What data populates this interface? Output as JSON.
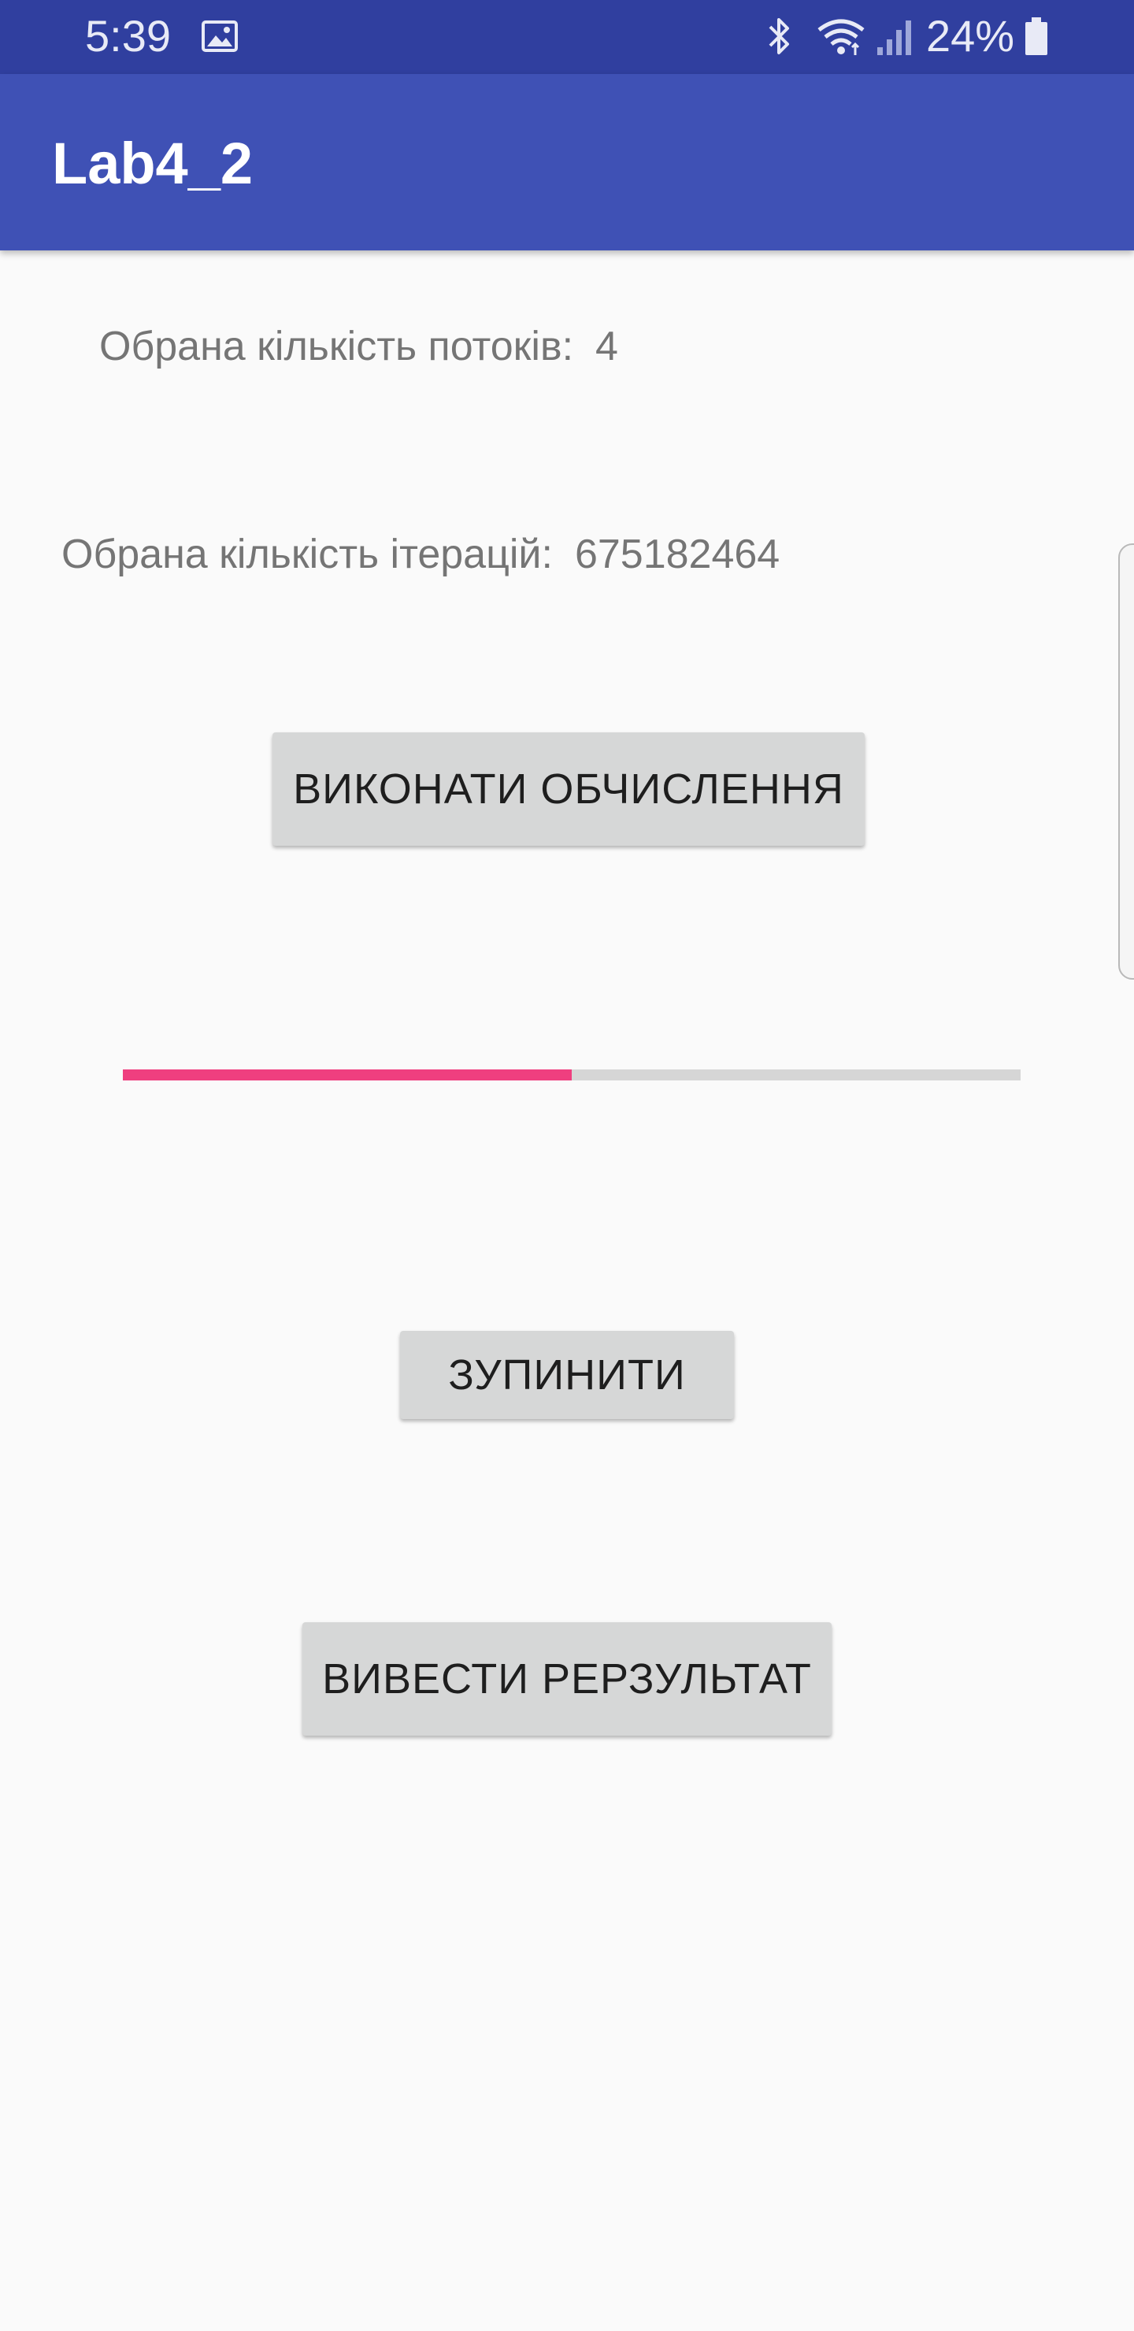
{
  "status_bar": {
    "time": "5:39",
    "battery": "24%",
    "background": "#303f9f",
    "icons": [
      "gallery-icon",
      "bluetooth-icon",
      "wifi-icon",
      "signal-icon",
      "battery-icon"
    ]
  },
  "app_bar": {
    "title": "Lab4_2",
    "background": "#3f51b5"
  },
  "threads": {
    "label": "Обрана кількість потоків:",
    "value": "4"
  },
  "iterations": {
    "label": "Обрана кількість ітерацій:",
    "value": "675182464"
  },
  "buttons": {
    "run": "ВИКОНАТИ ОБЧИСЛЕННЯ",
    "stop": "ЗУПИНИТИ",
    "result": "ВИВЕСТИ РЕРЗУЛЬТАТ"
  },
  "progress": {
    "fraction": 0.5,
    "accent": "#ef3f7f",
    "track": "#d6d6d6"
  }
}
